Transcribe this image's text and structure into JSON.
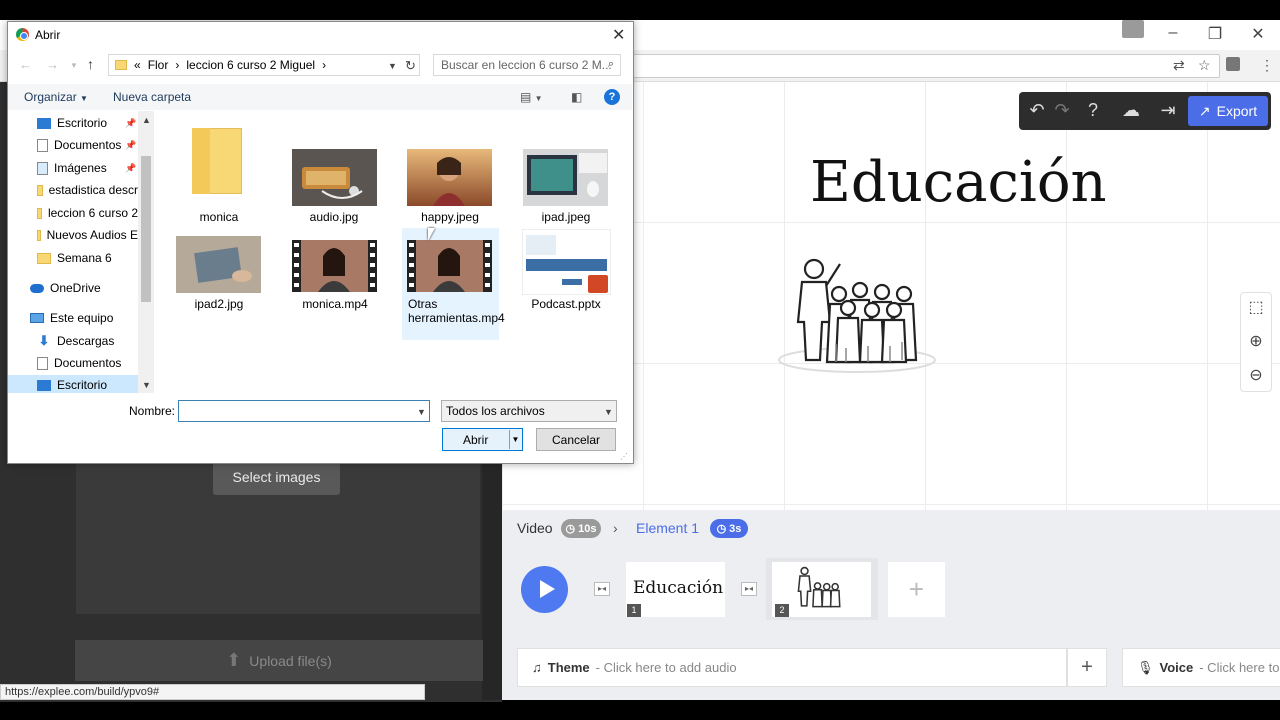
{
  "dialog": {
    "title": "Abrir",
    "path": [
      "«",
      "Flor",
      "leccion 6 curso 2 Miguel"
    ],
    "search_placeholder": "Buscar en leccion 6 curso 2 M...",
    "organize_label": "Organizar",
    "new_folder_label": "Nueva carpeta",
    "nav_items": [
      {
        "label": "Escritorio",
        "icon": "desktop-icon",
        "pinned": true
      },
      {
        "label": "Documentos",
        "icon": "documents-icon",
        "pinned": true
      },
      {
        "label": "Imágenes",
        "icon": "pictures-icon",
        "pinned": true
      },
      {
        "label": "estadistica descr",
        "icon": "folder-icon"
      },
      {
        "label": "leccion 6 curso 2",
        "icon": "folder-icon"
      },
      {
        "label": "Nuevos Audios E",
        "icon": "folder-icon"
      },
      {
        "label": "Semana 6",
        "icon": "folder-icon"
      },
      {
        "label": "OneDrive",
        "icon": "onedrive-icon"
      },
      {
        "label": "Este equipo",
        "icon": "computer-icon"
      },
      {
        "label": "Descargas",
        "icon": "downloads-icon"
      },
      {
        "label": "Documentos",
        "icon": "documents-icon"
      },
      {
        "label": "Escritorio",
        "icon": "desktop-icon"
      }
    ],
    "files": [
      {
        "name": "monica",
        "kind": "folder"
      },
      {
        "name": "audio.jpg",
        "kind": "image"
      },
      {
        "name": "happy.jpeg",
        "kind": "image"
      },
      {
        "name": "ipad.jpeg",
        "kind": "image"
      },
      {
        "name": "ipad2.jpg",
        "kind": "image"
      },
      {
        "name": "monica.mp4",
        "kind": "video"
      },
      {
        "name": "Otras herramientas.mp4",
        "kind": "video"
      },
      {
        "name": "Podcast.pptx",
        "kind": "pptx"
      }
    ],
    "filename_label": "Nombre:",
    "filename_value": "",
    "filter_value": "Todos los archivos",
    "open_label": "Abrir",
    "cancel_label": "Cancelar"
  },
  "app": {
    "slide_title": "Educación",
    "select_images_label": "Select images",
    "upload_label": "Upload file(s)",
    "status_url": "https://explee.com/build/ypvo9#",
    "export_label": "Export",
    "accent_color": "#4b6de8",
    "timeline": {
      "video_label": "Video",
      "video_duration": "10s",
      "element_label": "Element 1",
      "element_duration": "3s",
      "thumb1_title": "Educación",
      "thumb1_num": "1",
      "thumb2_num": "2",
      "theme_label": "Theme",
      "theme_hint": "- Click here to add audio",
      "voice_label": "Voice",
      "voice_hint": "- Click here to ac"
    }
  }
}
